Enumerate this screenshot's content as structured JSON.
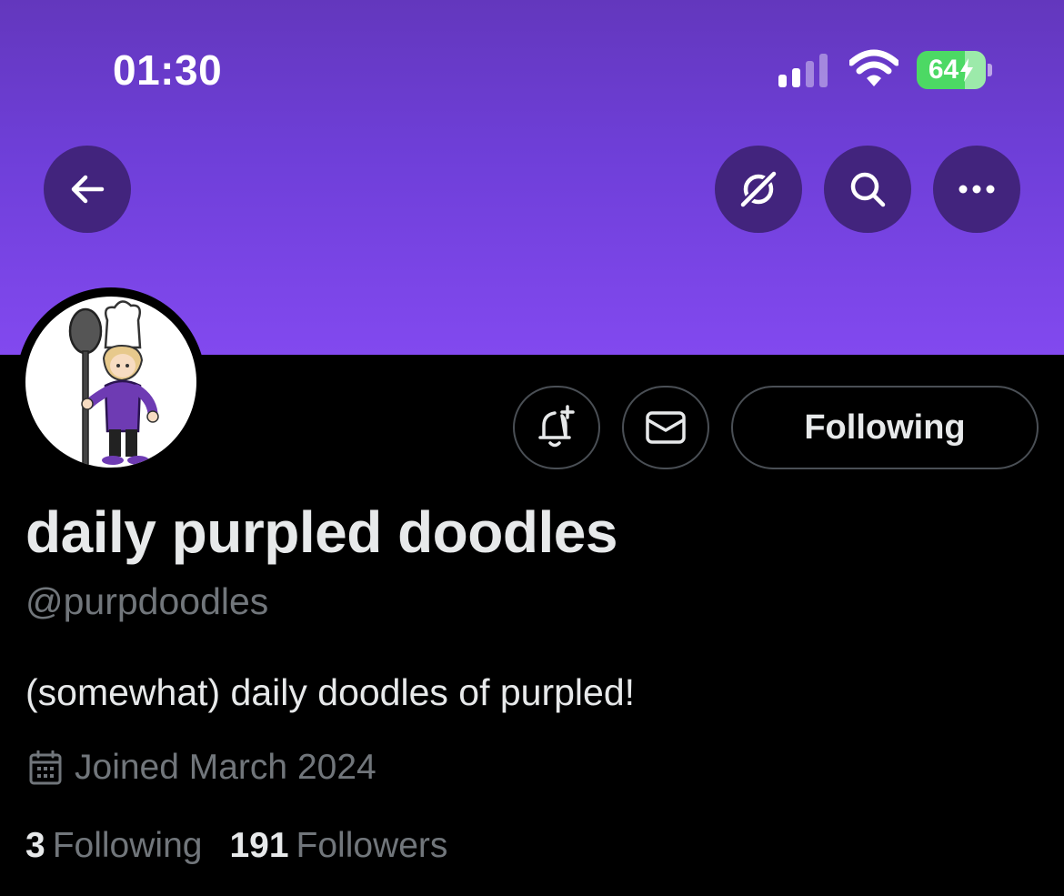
{
  "status_bar": {
    "time": "01:30",
    "battery_percent": "64",
    "icons": [
      "cellular-signal-icon",
      "wifi-icon",
      "battery-charging-icon"
    ]
  },
  "banner": {
    "color_top": "#6337bd",
    "color_bottom": "#8249ef",
    "buttons": [
      "back-arrow-icon",
      "grok-icon",
      "search-icon",
      "more-icon"
    ]
  },
  "profile": {
    "display_name": "daily purpled doodles",
    "handle": "@purpdoodles",
    "bio": "(somewhat) daily doodles of purpled!",
    "joined": "Joined March 2024",
    "following_count": "3",
    "following_label": "Following",
    "followers_count": "191",
    "followers_label": "Followers",
    "avatar_icon": "chef-character-avatar"
  },
  "actions": {
    "notify_icon": "bell-plus-icon",
    "message_icon": "envelope-icon",
    "follow_button_label": "Following"
  },
  "colors": {
    "background": "#000000",
    "primary_text": "#e7e9ea",
    "secondary_text": "#71767b",
    "button_border": "#4a4f55",
    "nav_button": "#42247d",
    "battery_green": "#4cd964"
  }
}
